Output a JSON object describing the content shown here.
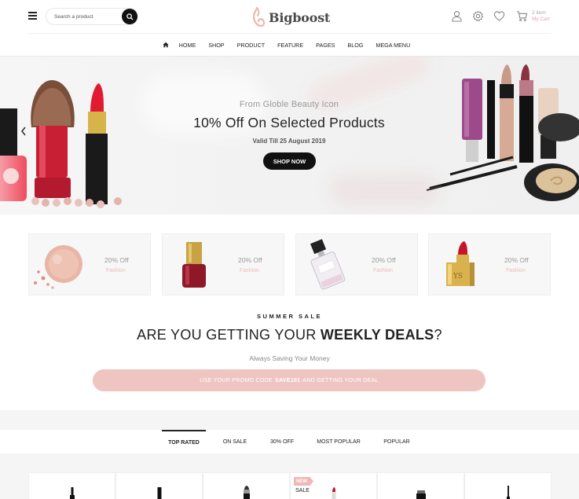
{
  "header": {
    "search_placeholder": "Search a product",
    "logo_text": "Bigboost",
    "cart_count": "2 item",
    "cart_label": "My Cart",
    "nav": [
      "HOME",
      "SHOP",
      "PRODUCT",
      "FEATURE",
      "PAGES",
      "BLOG",
      "MEGA MENU"
    ]
  },
  "hero": {
    "subtitle": "From Globle Beauty Icon",
    "title": "10% Off On Selected Products",
    "valid": "Valid Till 25 August 2019",
    "button": "SHOP NOW"
  },
  "categories": [
    {
      "offer": "20% Off",
      "label": "Fashion",
      "icon": "powder-compact"
    },
    {
      "offer": "20% Off",
      "label": "Fashion",
      "icon": "nail-polish"
    },
    {
      "offer": "20% Off",
      "label": "Fashion",
      "icon": "perfume-bottle"
    },
    {
      "offer": "20% Off",
      "label": "Fashion",
      "icon": "lipstick"
    }
  ],
  "deals": {
    "kicker": "SUMMER SALE",
    "headline_regular": "ARE YOU GETTING YOUR",
    "headline_bold": "WEEKLY DEALS",
    "headline_end": "?",
    "subtitle": "Always Saving Your Money",
    "promo_before": "USE YOUR PROMO CODE",
    "promo_code": "SAVE101",
    "promo_after": "AND GETTING YOUR DEAL"
  },
  "tabs": {
    "items": [
      "TOP RATED",
      "ON SALE",
      "30% OFF",
      "MOST POPULAR",
      "POPULAR"
    ],
    "active": "TOP RATED"
  },
  "products": {
    "badge_new": "NEW",
    "badge_sale": "SALE"
  },
  "colors": {
    "accent_pink": "#efc5c2",
    "label_pink": "#f1b9b9",
    "dark": "#111111"
  }
}
